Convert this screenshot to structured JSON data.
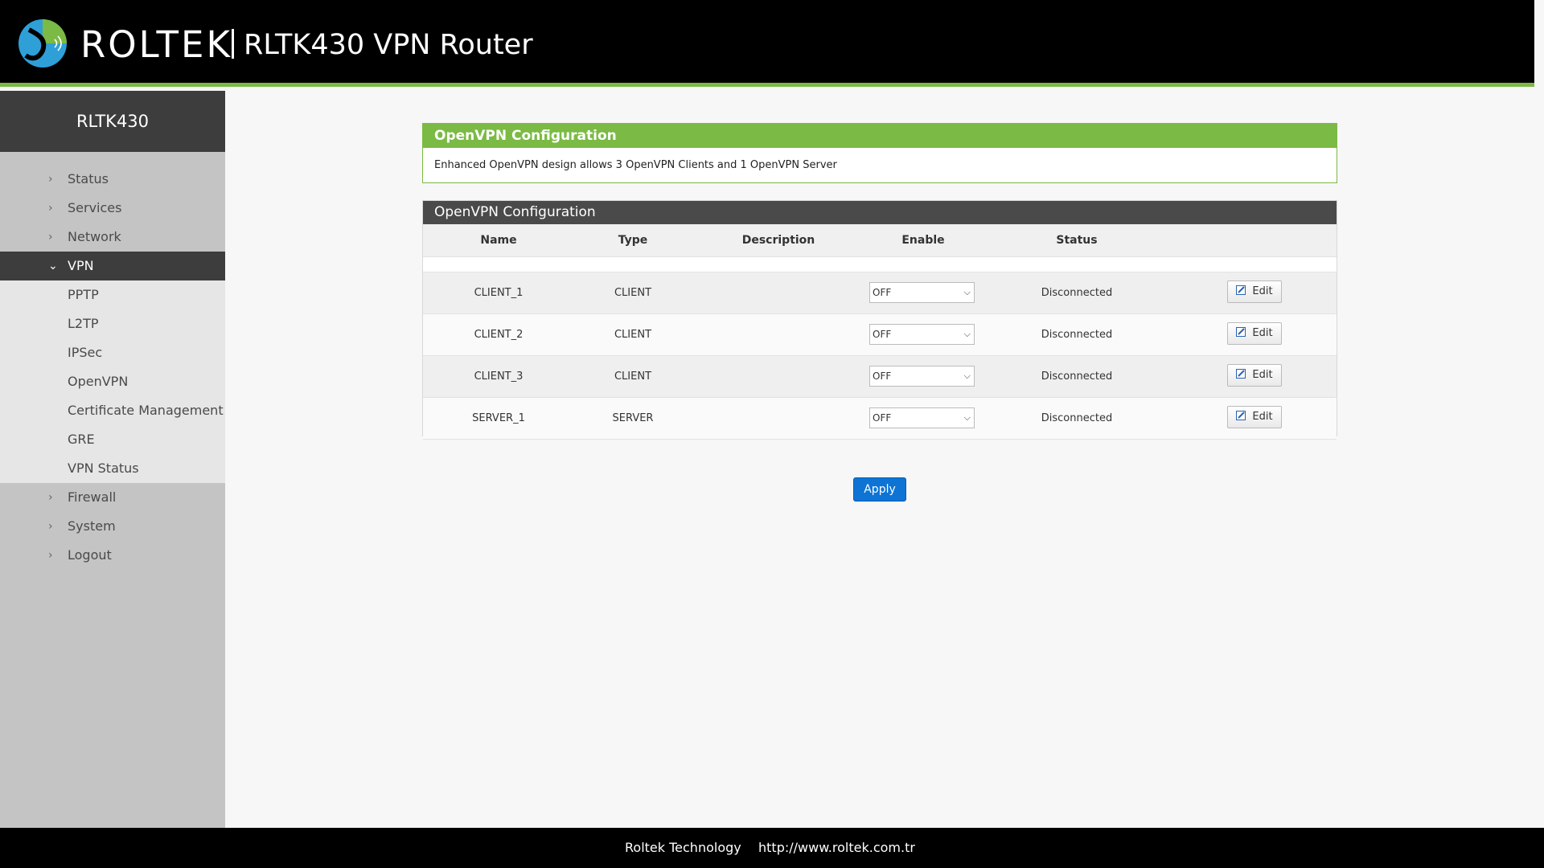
{
  "header": {
    "brand": "ROLTEK",
    "model_title": "RLTK430 VPN Router"
  },
  "sidebar": {
    "device_name": "RLTK430",
    "items_top": [
      {
        "label": "Status"
      },
      {
        "label": "Services"
      },
      {
        "label": "Network"
      }
    ],
    "active": {
      "label": "VPN"
    },
    "sub_items": [
      {
        "label": "PPTP"
      },
      {
        "label": "L2TP"
      },
      {
        "label": "IPSec"
      },
      {
        "label": "OpenVPN"
      },
      {
        "label": "Certificate Management"
      },
      {
        "label": "GRE"
      },
      {
        "label": "VPN Status"
      }
    ],
    "items_bottom": [
      {
        "label": "Firewall"
      },
      {
        "label": "System"
      },
      {
        "label": "Logout"
      }
    ]
  },
  "info": {
    "title": "OpenVPN Configuration",
    "text": "Enhanced OpenVPN design allows 3 OpenVPN Clients and 1 OpenVPN Server"
  },
  "table": {
    "title": "OpenVPN Configuration",
    "columns": {
      "name": "Name",
      "type": "Type",
      "description": "Description",
      "enable": "Enable",
      "status": "Status"
    },
    "rows": [
      {
        "name": "CLIENT_1",
        "type": "CLIENT",
        "description": "",
        "enable": "OFF",
        "status": "Disconnected",
        "edit": "Edit"
      },
      {
        "name": "CLIENT_2",
        "type": "CLIENT",
        "description": "",
        "enable": "OFF",
        "status": "Disconnected",
        "edit": "Edit"
      },
      {
        "name": "CLIENT_3",
        "type": "CLIENT",
        "description": "",
        "enable": "OFF",
        "status": "Disconnected",
        "edit": "Edit"
      },
      {
        "name": "SERVER_1",
        "type": "SERVER",
        "description": "",
        "enable": "OFF",
        "status": "Disconnected",
        "edit": "Edit"
      }
    ]
  },
  "apply_label": "Apply",
  "footer": {
    "company": "Roltek Technology",
    "url": "http://www.roltek.com.tr"
  },
  "icons": {
    "collapsed": "chevron-right-icon",
    "expanded": "chevron-down-icon",
    "edit": "edit-icon",
    "select": "dropdown-arrow-icon"
  },
  "colors": {
    "accent_green": "#7bba44",
    "header_bg": "#000000",
    "dark_panel": "#3d3d3d",
    "apply_blue": "#0d74d6"
  }
}
